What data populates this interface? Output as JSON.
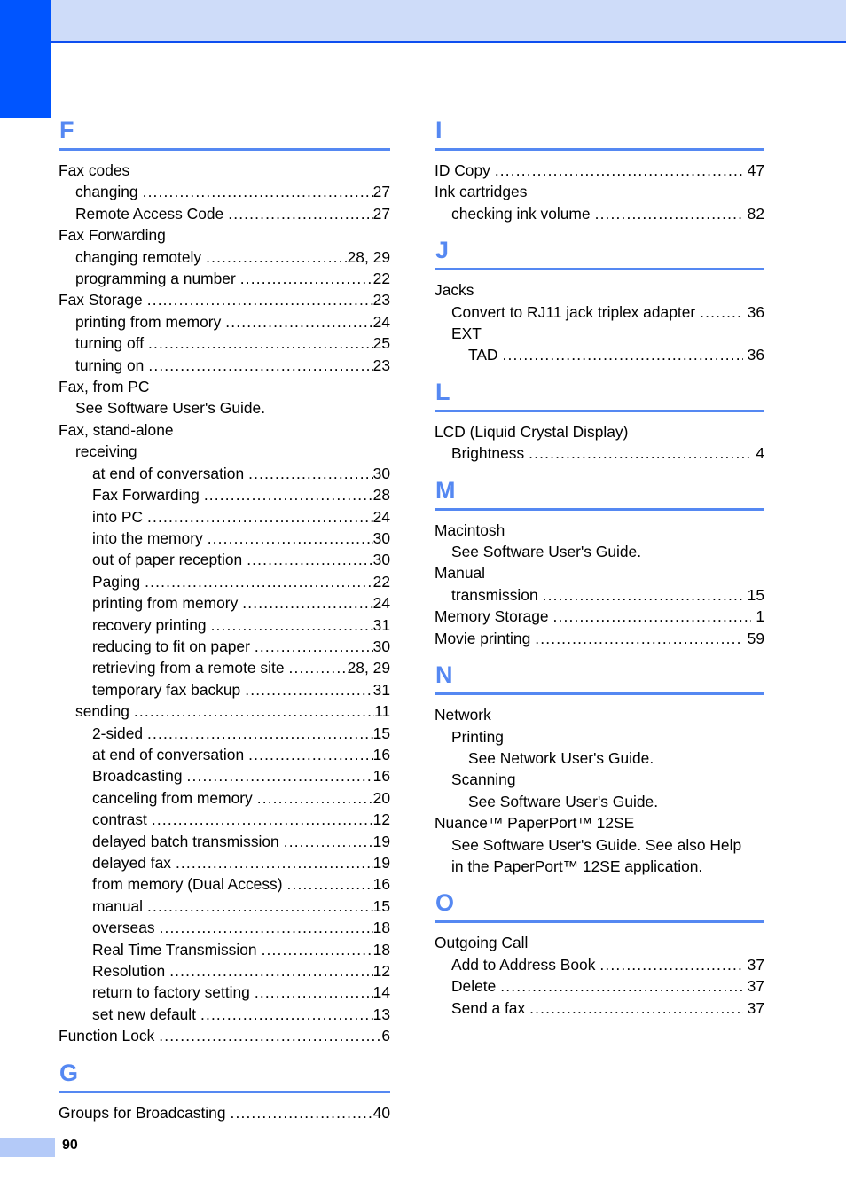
{
  "page": {
    "number": "90",
    "accent_color": "#5588f2",
    "header_tab_color": "#0055ff",
    "header_band_color": "#cedcf9",
    "header_rule_color": "#0d4ef0",
    "footer_block_color": "#b4caf8"
  },
  "columns": {
    "left": [
      {
        "letter": "F",
        "entries": [
          {
            "level": 0,
            "label": "Fax codes",
            "leader": false,
            "page": ""
          },
          {
            "level": 1,
            "label": "changing",
            "leader": true,
            "page": "27"
          },
          {
            "level": 1,
            "label": "Remote Access Code",
            "leader": true,
            "page": "27"
          },
          {
            "level": 0,
            "label": "Fax Forwarding",
            "leader": false,
            "page": ""
          },
          {
            "level": 1,
            "label": "changing remotely",
            "leader": true,
            "page": "28, 29"
          },
          {
            "level": 1,
            "label": "programming a number",
            "leader": true,
            "page": "22"
          },
          {
            "level": 0,
            "label": "Fax Storage",
            "leader": true,
            "page": "23"
          },
          {
            "level": 1,
            "label": "printing from memory",
            "leader": true,
            "page": "24"
          },
          {
            "level": 1,
            "label": "turning off",
            "leader": true,
            "page": "25"
          },
          {
            "level": 1,
            "label": "turning on",
            "leader": true,
            "page": "23"
          },
          {
            "level": 0,
            "label": "Fax, from PC",
            "leader": false,
            "page": ""
          },
          {
            "level": 1,
            "label": "See Software User's Guide.",
            "leader": false,
            "page": ""
          },
          {
            "level": 0,
            "label": "Fax, stand-alone",
            "leader": false,
            "page": ""
          },
          {
            "level": 1,
            "label": "receiving",
            "leader": false,
            "page": ""
          },
          {
            "level": 2,
            "label": "at end of conversation",
            "leader": true,
            "page": "30"
          },
          {
            "level": 2,
            "label": "Fax Forwarding",
            "leader": true,
            "page": "28"
          },
          {
            "level": 2,
            "label": "into PC",
            "leader": true,
            "page": "24"
          },
          {
            "level": 2,
            "label": "into the memory",
            "leader": true,
            "page": "30"
          },
          {
            "level": 2,
            "label": "out of paper reception",
            "leader": true,
            "page": "30"
          },
          {
            "level": 2,
            "label": "Paging",
            "leader": true,
            "page": "22"
          },
          {
            "level": 2,
            "label": "printing from memory",
            "leader": true,
            "page": "24"
          },
          {
            "level": 2,
            "label": "recovery printing",
            "leader": true,
            "page": "31"
          },
          {
            "level": 2,
            "label": "reducing to fit on paper",
            "leader": true,
            "page": "30"
          },
          {
            "level": 2,
            "label": "retrieving from a remote site",
            "leader": true,
            "page": "28, 29"
          },
          {
            "level": 2,
            "label": "temporary fax backup",
            "leader": true,
            "page": "31"
          },
          {
            "level": 1,
            "label": "sending",
            "leader": true,
            "page": "11"
          },
          {
            "level": 2,
            "label": "2-sided",
            "leader": true,
            "page": "15"
          },
          {
            "level": 2,
            "label": "at end of conversation",
            "leader": true,
            "page": "16"
          },
          {
            "level": 2,
            "label": "Broadcasting",
            "leader": true,
            "page": "16"
          },
          {
            "level": 2,
            "label": "canceling from memory",
            "leader": true,
            "page": "20"
          },
          {
            "level": 2,
            "label": "contrast",
            "leader": true,
            "page": "12"
          },
          {
            "level": 2,
            "label": "delayed batch transmission",
            "leader": true,
            "page": "19"
          },
          {
            "level": 2,
            "label": "delayed fax",
            "leader": true,
            "page": "19"
          },
          {
            "level": 2,
            "label": "from memory (Dual Access)",
            "leader": true,
            "page": "16"
          },
          {
            "level": 2,
            "label": "manual",
            "leader": true,
            "page": "15"
          },
          {
            "level": 2,
            "label": "overseas",
            "leader": true,
            "page": "18"
          },
          {
            "level": 2,
            "label": "Real Time Transmission",
            "leader": true,
            "page": "18"
          },
          {
            "level": 2,
            "label": "Resolution",
            "leader": true,
            "page": "12"
          },
          {
            "level": 2,
            "label": "return to factory setting",
            "leader": true,
            "page": "14"
          },
          {
            "level": 2,
            "label": "set new default",
            "leader": true,
            "page": "13"
          },
          {
            "level": 0,
            "label": "Function Lock",
            "leader": true,
            "page": "6"
          }
        ]
      },
      {
        "letter": "G",
        "entries": [
          {
            "level": 0,
            "label": "Groups for Broadcasting",
            "leader": true,
            "page": "40"
          }
        ]
      }
    ],
    "right": [
      {
        "letter": "I",
        "entries": [
          {
            "level": 0,
            "label": "ID Copy",
            "leader": true,
            "page": "47"
          },
          {
            "level": 0,
            "label": "Ink cartridges",
            "leader": false,
            "page": ""
          },
          {
            "level": 1,
            "label": "checking ink volume",
            "leader": true,
            "page": "82"
          }
        ]
      },
      {
        "letter": "J",
        "entries": [
          {
            "level": 0,
            "label": "Jacks",
            "leader": false,
            "page": ""
          },
          {
            "level": 1,
            "label": "Convert to RJ11 jack triplex adapter",
            "leader": true,
            "page": "36"
          },
          {
            "level": 1,
            "label": "EXT",
            "leader": false,
            "page": ""
          },
          {
            "level": 2,
            "label": "TAD",
            "leader": true,
            "page": "36"
          }
        ]
      },
      {
        "letter": "L",
        "entries": [
          {
            "level": 0,
            "label": "LCD (Liquid Crystal Display)",
            "leader": false,
            "page": ""
          },
          {
            "level": 1,
            "label": "Brightness",
            "leader": true,
            "page": "4"
          }
        ]
      },
      {
        "letter": "M",
        "entries": [
          {
            "level": 0,
            "label": "Macintosh",
            "leader": false,
            "page": ""
          },
          {
            "level": 1,
            "label": "See Software User's Guide.",
            "leader": false,
            "page": ""
          },
          {
            "level": 0,
            "label": "Manual",
            "leader": false,
            "page": ""
          },
          {
            "level": 1,
            "label": "transmission",
            "leader": true,
            "page": "15"
          },
          {
            "level": 0,
            "label": "Memory Storage",
            "leader": true,
            "page": "1"
          },
          {
            "level": 0,
            "label": "Movie printing",
            "leader": true,
            "page": "59"
          }
        ]
      },
      {
        "letter": "N",
        "entries": [
          {
            "level": 0,
            "label": "Network",
            "leader": false,
            "page": ""
          },
          {
            "level": 1,
            "label": "Printing",
            "leader": false,
            "page": ""
          },
          {
            "level": 2,
            "label": "See Network User's Guide.",
            "leader": false,
            "page": ""
          },
          {
            "level": 1,
            "label": "Scanning",
            "leader": false,
            "page": ""
          },
          {
            "level": 2,
            "label": "See Software User's Guide.",
            "leader": false,
            "page": ""
          },
          {
            "level": 0,
            "label": "Nuance™ PaperPort™ 12SE",
            "leader": false,
            "page": ""
          },
          {
            "level": 1,
            "label": "See Software User's Guide. See also Help",
            "leader": false,
            "page": ""
          },
          {
            "level": 1,
            "label": "in the PaperPort™ 12SE application.",
            "leader": false,
            "page": ""
          }
        ]
      },
      {
        "letter": "O",
        "entries": [
          {
            "level": 0,
            "label": "Outgoing Call",
            "leader": false,
            "page": ""
          },
          {
            "level": 1,
            "label": "Add to Address Book",
            "leader": true,
            "page": "37"
          },
          {
            "level": 1,
            "label": "Delete",
            "leader": true,
            "page": "37"
          },
          {
            "level": 1,
            "label": "Send a fax",
            "leader": true,
            "page": "37"
          }
        ]
      }
    ]
  }
}
